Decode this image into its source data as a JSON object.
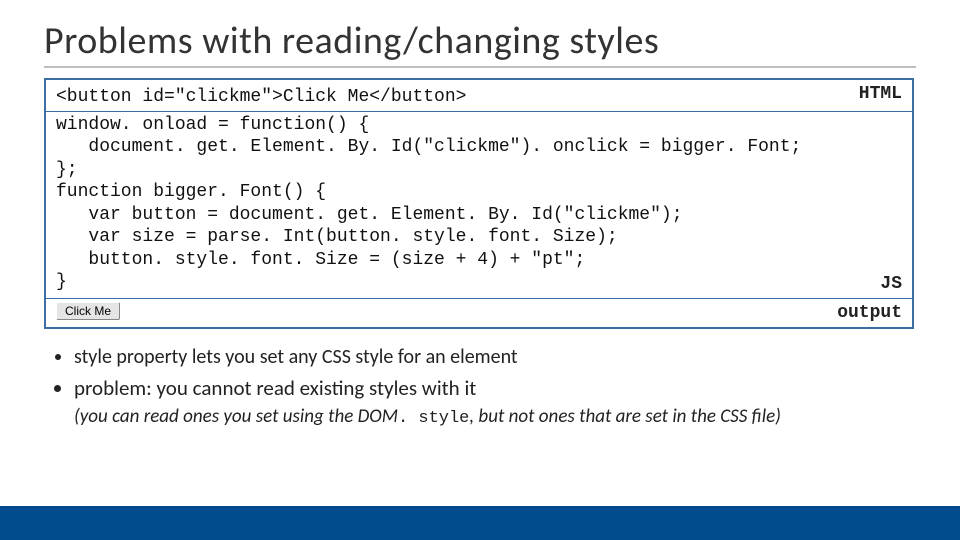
{
  "title": "Problems with reading/changing styles",
  "code": {
    "html_tag": "HTML",
    "js_tag": "JS",
    "output_tag": "output",
    "html_line": "<button id=\"clickme\">Click Me</button>",
    "js_lines": "window. onload = function() {\n   document. get. Element. By. Id(\"clickme\"). onclick = bigger. Font;\n};\nfunction bigger. Font() {\n   var button = document. get. Element. By. Id(\"clickme\");\n   var size = parse. Int(button. style. font. Size);\n   button. style. font. Size = (size + 4) + \"pt\";\n}",
    "output_button": "Click Me"
  },
  "bullets": {
    "b1": "style property lets you set any CSS style for an element",
    "b2": "problem: you cannot read existing styles with it",
    "b3_pre": "(you can read ones you set using the DOM",
    "b3_mono": ". style",
    "b3_post": ", but not ones that are set in the CSS file)"
  }
}
